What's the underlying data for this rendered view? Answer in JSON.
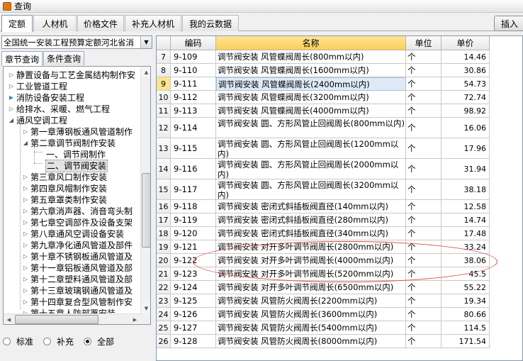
{
  "window": {
    "title": "查询"
  },
  "tabs": [
    "定额",
    "人材机",
    "价格文件",
    "补充人材机",
    "我的云数据"
  ],
  "insert_button": "插入",
  "library": {
    "selected": "全国统一安装工程预算定额河北省消"
  },
  "subtabs": [
    "章节查询",
    "条件查询"
  ],
  "tree": [
    {
      "label": "静置设备与工艺金属结构制作安",
      "level": 0,
      "expander": "▷"
    },
    {
      "label": "工业管道工程",
      "level": 0,
      "expander": "▷"
    },
    {
      "label": "消防设备安装工程",
      "level": 0,
      "expander": "▶"
    },
    {
      "label": "给排水、采暖、燃气工程",
      "level": 0,
      "expander": "▷"
    },
    {
      "label": "通风空调工程",
      "level": 0,
      "expander": "◢"
    },
    {
      "label": "第一章薄钢板通风管道制作",
      "level": 1,
      "expander": "▷"
    },
    {
      "label": "第二章调节阀制作安装",
      "level": 1,
      "expander": "◢"
    },
    {
      "label": "一、调节阀制作",
      "level": 2,
      "expander": ""
    },
    {
      "label": "二、调节阀安装",
      "level": 2,
      "expander": ""
    },
    {
      "label": "第三章风口制作安装",
      "level": 1,
      "expander": "▷"
    },
    {
      "label": "第四章风帽制作安装",
      "level": 1,
      "expander": "▷"
    },
    {
      "label": "第五章罩类制作安装",
      "level": 1,
      "expander": "▷"
    },
    {
      "label": "第六章消声器、消音弯头制",
      "level": 1,
      "expander": "▷"
    },
    {
      "label": "第七章空调部件及设备支架",
      "level": 1,
      "expander": "▷"
    },
    {
      "label": "第八章通风空调设备安装",
      "level": 1,
      "expander": "▷"
    },
    {
      "label": "第九章净化通风管道及部件",
      "level": 1,
      "expander": "▷"
    },
    {
      "label": "第十章不锈钢板通风管道及",
      "level": 1,
      "expander": "▷"
    },
    {
      "label": "第十一章铝板通风管道及部",
      "level": 1,
      "expander": "▷"
    },
    {
      "label": "第十二章塑料通风管道及部",
      "level": 1,
      "expander": "▷"
    },
    {
      "label": "第十三章玻璃钢通风管道及",
      "level": 1,
      "expander": "▷"
    },
    {
      "label": "第十四章复合型风管制作安",
      "level": 1,
      "expander": "▷"
    },
    {
      "label": "第十五章人防部署安装",
      "level": 1,
      "expander": "▷"
    }
  ],
  "radios": [
    {
      "label": "标准",
      "checked": false
    },
    {
      "label": "补充",
      "checked": false
    },
    {
      "label": "全部",
      "checked": true
    }
  ],
  "grid": {
    "columns": [
      "",
      "编码",
      "名称",
      "单位",
      "单价"
    ],
    "rows": [
      {
        "n": "7",
        "code": "9-109",
        "name": "调节阀安装 风管蝶阀周长(800mm以内)",
        "unit": "个",
        "price": "14.46"
      },
      {
        "n": "8",
        "code": "9-110",
        "name": "调节阀安装 风管蝶阀周长(1600mm以内)",
        "unit": "个",
        "price": "30.86"
      },
      {
        "n": "9",
        "code": "9-111",
        "name": "调节阀安装 风管蝶阀周长(2400mm以内)",
        "unit": "个",
        "price": "54.73"
      },
      {
        "n": "10",
        "code": "9-112",
        "name": "调节阀安装 风管蝶阀周长(3200mm以内)",
        "unit": "个",
        "price": "72.74"
      },
      {
        "n": "11",
        "code": "9-113",
        "name": "调节阀安装 风管蝶阀周长(4000mm以内)",
        "unit": "个",
        "price": "98.92"
      },
      {
        "n": "12",
        "code": "9-114",
        "name": "调节阀安装 圆、方形风管止回阀周长(800mm以内)",
        "unit": "个",
        "price": "16.06"
      },
      {
        "n": "13",
        "code": "9-115",
        "name": "调节阀安装 圆、方形风管止回阀周长(1200mm以内)",
        "unit": "个",
        "price": "17.96"
      },
      {
        "n": "14",
        "code": "9-116",
        "name": "调节阀安装 圆、方形风管止回阀周长(2000mm以内)",
        "unit": "个",
        "price": "31.94"
      },
      {
        "n": "15",
        "code": "9-117",
        "name": "调节阀安装 圆、方形风管止回阀周长(3200mm以内)",
        "unit": "个",
        "price": "38.18"
      },
      {
        "n": "16",
        "code": "9-118",
        "name": "调节阀安装 密闭式斜插板阀直径(140mm以内)",
        "unit": "个",
        "price": "12.58"
      },
      {
        "n": "17",
        "code": "9-119",
        "name": "调节阀安装 密闭式斜插板阀直径(280mm以内)",
        "unit": "个",
        "price": "14.74"
      },
      {
        "n": "18",
        "code": "9-120",
        "name": "调节阀安装 密闭式斜插板阀直径(340mm以内)",
        "unit": "个",
        "price": "17.48"
      },
      {
        "n": "19",
        "code": "9-121",
        "name": "调节阀安装 对开多叶调节阀周长(2800mm以内)",
        "unit": "个",
        "price": "33.24"
      },
      {
        "n": "20",
        "code": "9-122",
        "name": "调节阀安装 对开多叶调节阀周长(4000mm以内)",
        "unit": "个",
        "price": "38.06"
      },
      {
        "n": "21",
        "code": "9-123",
        "name": "调节阀安装 对开多叶调节阀周长(5200mm以内)",
        "unit": "个",
        "price": "45.5"
      },
      {
        "n": "22",
        "code": "9-124",
        "name": "调节阀安装 对开多叶调节阀周长(6500mm以内)",
        "unit": "个",
        "price": "55.22"
      },
      {
        "n": "23",
        "code": "9-125",
        "name": "调节阀安装 风管防火阀周长(2200mm以内)",
        "unit": "个",
        "price": "19.34"
      },
      {
        "n": "24",
        "code": "9-126",
        "name": "调节阀安装 风管防火阀周长(3600mm以内)",
        "unit": "个",
        "price": "80.66"
      },
      {
        "n": "25",
        "code": "9-127",
        "name": "调节阀安装 风管防火阀周长(5400mm以内)",
        "unit": "个",
        "price": "114.5"
      },
      {
        "n": "26",
        "code": "9-128",
        "name": "调节阀安装 风管防火阀周长(8000mm以内)",
        "unit": "个",
        "price": "171.54"
      }
    ]
  }
}
